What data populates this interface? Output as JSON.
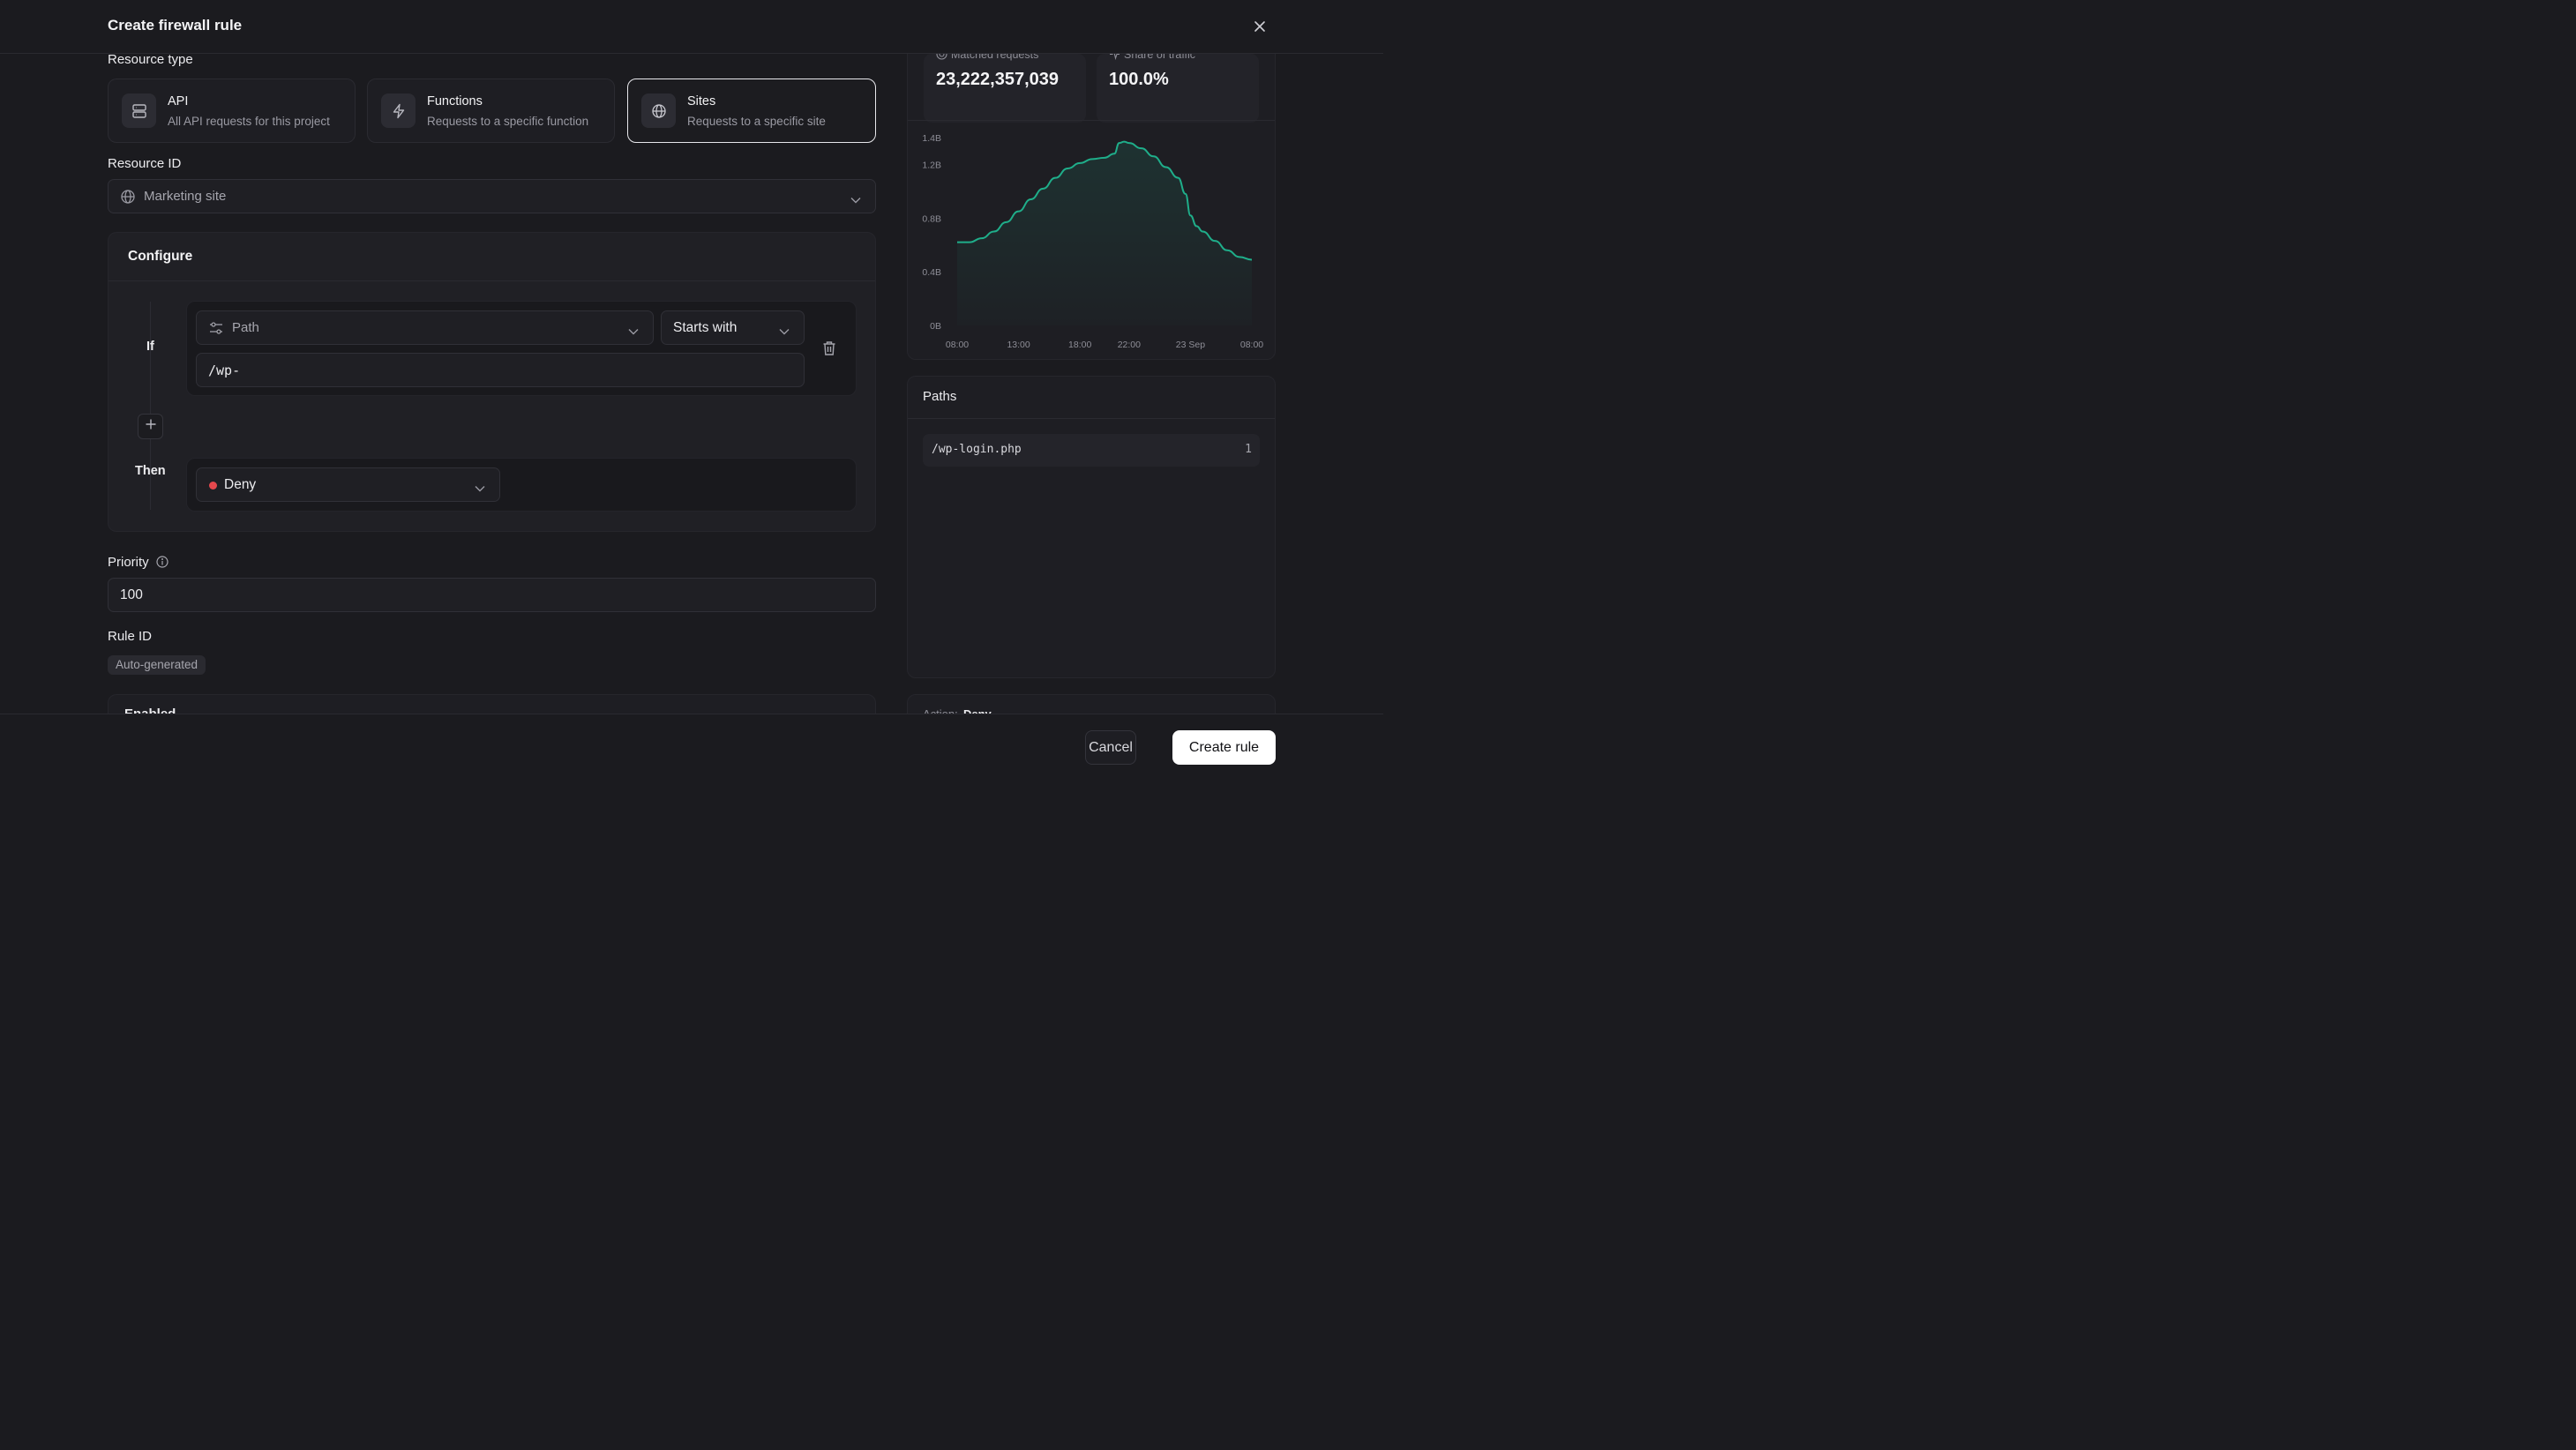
{
  "header": {
    "title": "Create firewall rule",
    "close_icon": "close-icon"
  },
  "resource_type": {
    "label": "Resource type",
    "options": [
      {
        "title": "API",
        "description": "All API requests for this project",
        "icon": "server-icon",
        "selected": false
      },
      {
        "title": "Functions",
        "description": "Requests to a specific function",
        "icon": "lightning-icon",
        "selected": false
      },
      {
        "title": "Sites",
        "description": "Requests to a specific site",
        "icon": "globe-icon",
        "selected": true
      }
    ]
  },
  "resource_id": {
    "label": "Resource ID",
    "value": "Marketing site"
  },
  "configure": {
    "title": "Configure",
    "if_label": "If",
    "then_label": "Then",
    "field": "Path",
    "operator": "Starts with",
    "value": "/wp-",
    "action": "Deny",
    "action_color": "#e5484d"
  },
  "priority": {
    "label": "Priority",
    "value": "100"
  },
  "rule_id": {
    "label": "Rule ID",
    "badge": "Auto-generated"
  },
  "enabled": {
    "label": "Enabled"
  },
  "stats": {
    "matched_label": "Matched requests",
    "matched_value": "23,222,357,039",
    "share_label": "Share of traffic",
    "share_value": "100.0%"
  },
  "chart_data": {
    "type": "area",
    "color": "#1fae8a",
    "yticks": [
      "1.4B",
      "1.2B",
      "0.8B",
      "0.4B",
      "0B"
    ],
    "ytick_values": [
      1.4,
      1.2,
      0.8,
      0.4,
      0
    ],
    "xticks": [
      "08:00",
      "13:00",
      "18:00",
      "22:00",
      "23 Sep",
      "08:00"
    ],
    "xtick_hours": [
      0,
      5,
      10,
      14,
      19,
      24
    ],
    "ylim": [
      0,
      1.4
    ],
    "unit": "B",
    "points": [
      [
        0,
        0.62
      ],
      [
        0.5,
        0.62
      ],
      [
        1,
        0.62
      ],
      [
        2,
        0.65
      ],
      [
        3,
        0.7
      ],
      [
        4,
        0.77
      ],
      [
        5,
        0.85
      ],
      [
        6,
        0.94
      ],
      [
        7,
        1.02
      ],
      [
        8,
        1.1
      ],
      [
        9,
        1.17
      ],
      [
        10,
        1.21
      ],
      [
        11,
        1.24
      ],
      [
        12,
        1.25
      ],
      [
        12.8,
        1.28
      ],
      [
        13.2,
        1.36
      ],
      [
        13.6,
        1.37
      ],
      [
        14,
        1.36
      ],
      [
        15,
        1.32
      ],
      [
        16,
        1.26
      ],
      [
        17,
        1.18
      ],
      [
        18,
        1.1
      ],
      [
        18.6,
        0.98
      ],
      [
        19,
        0.82
      ],
      [
        19.5,
        0.74
      ],
      [
        20,
        0.7
      ],
      [
        21,
        0.63
      ],
      [
        22,
        0.56
      ],
      [
        23,
        0.51
      ],
      [
        24,
        0.49
      ]
    ]
  },
  "paths": {
    "title": "Paths",
    "rows": [
      {
        "path": "/wp-login.php",
        "count": "1"
      }
    ]
  },
  "summary": {
    "action_label": "Action:",
    "action_value": "Deny"
  },
  "footer": {
    "cancel": "Cancel",
    "create": "Create rule"
  }
}
